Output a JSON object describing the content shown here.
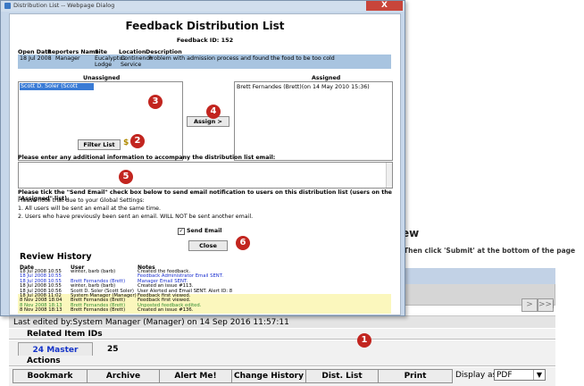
{
  "dialog": {
    "window_title": "Distribution List -- Webpage Dialog",
    "close_glyph": "X",
    "title": "Feedback Distribution List",
    "feedback_id": "Feedback ID: 152",
    "headers": {
      "open_date": "Open Date",
      "reporters_name": "Reporters Name",
      "site": "Site",
      "location": "Location",
      "description": "Description"
    },
    "info": {
      "open_date": "18 Jul 2008",
      "reporter": "Manager",
      "site_line1": "Eucalyptus",
      "site_line2": "Lodge",
      "location_line1": "Continence",
      "location_line2": "Service",
      "description": "Problem with admission process and found the food to be too cold"
    },
    "unassigned_label": "Unassigned",
    "assigned_label": "Assigned",
    "unassigned_selected": "Scott D. Soler (Scott Soler)",
    "assigned_item": "Brett Fernandes (Brett)(on 14 May 2010 15:36)",
    "assign_button": "Assign >",
    "filter_button": "Filter List",
    "dollar_icon": "$",
    "email_prompt": "Please enter any additional information to accompany the distribution list email:",
    "notice": "Please tick the \"Send Email\" check box below to send email notification to users on this distribution list (users on the \"Assigned\" list).",
    "notes": [
      "Please note that due to your Global Settings:",
      "1. All users will be sent an email at the same time.",
      "2. Users who have previously been sent an email. WILL NOT be sent another email."
    ],
    "send_email_label": "Send Email",
    "send_email_checked": "✓",
    "close_button": "Close",
    "review_history_title": "Review History",
    "review_headers": {
      "date": "Date",
      "user": "User",
      "notes": "Notes"
    },
    "review_rows": [
      {
        "date": "18 Jul 2008 10:55",
        "user": "winter, barb (barb)",
        "notes": "Created the feedback.",
        "color": "#000000"
      },
      {
        "date": "18 Jul 2008 10:55",
        "user": "",
        "notes": "Feedback Administrator Email SENT.",
        "color": "#1a2fd0"
      },
      {
        "date": "18 Jul 2008 10:55",
        "user": "Brett Fernandes (Brett)",
        "notes": "Manager Email SENT.",
        "color": "#1a2fd0"
      },
      {
        "date": "18 Jul 2008 10:55",
        "user": "winter, barb (barb)",
        "notes": "Created an issue #113.",
        "color": "#000000"
      },
      {
        "date": "18 Jul 2008 10:56",
        "user": "Scott D. Soler (Scott Soler)",
        "notes": "User Alerted and Email SENT. Alert ID: 8",
        "color": "#000000"
      },
      {
        "date": "18 Jul 2008 11:02",
        "user": "System Manager (Manager)",
        "notes": "Feedback first viewed.",
        "color": "#000000"
      },
      {
        "date": "8 Nov 2008 18:04",
        "user": "Brett Fernandes (Brett)",
        "notes": "Feedback first viewed.",
        "color": "#000000"
      },
      {
        "date": "8 Nov 2008 18:13",
        "user": "Brett Fernandes (Brett)",
        "notes": "Unposted feedback edited.",
        "color": "#2e8b2e"
      },
      {
        "date": "8 Nov 2008 18:13",
        "user": "Brett Fernandes (Brett)",
        "notes": "Created an issue #136.",
        "color": "#000000"
      }
    ]
  },
  "markers": [
    "1",
    "2",
    "3",
    "4",
    "5",
    "6"
  ],
  "background": {
    "heading": "ew",
    "instruction": "Then click 'Submit' at the bottom of the page",
    "pager_next": ">",
    "pager_last": ">>|",
    "last_edited": "Last edited by:System Manager (Manager) on 14 Sep 2016 11:57:11",
    "related_header": "Related Item IDs",
    "master_button": "24 Master",
    "master_count": "25",
    "actions_header": "Actions",
    "actions": [
      "Bookmark",
      "Archive",
      "Alert Me!",
      "Change History",
      "Dist. List",
      "Print"
    ],
    "display_as_label": "Display as:",
    "display_as_value": "PDF",
    "select_caret": "▼"
  }
}
